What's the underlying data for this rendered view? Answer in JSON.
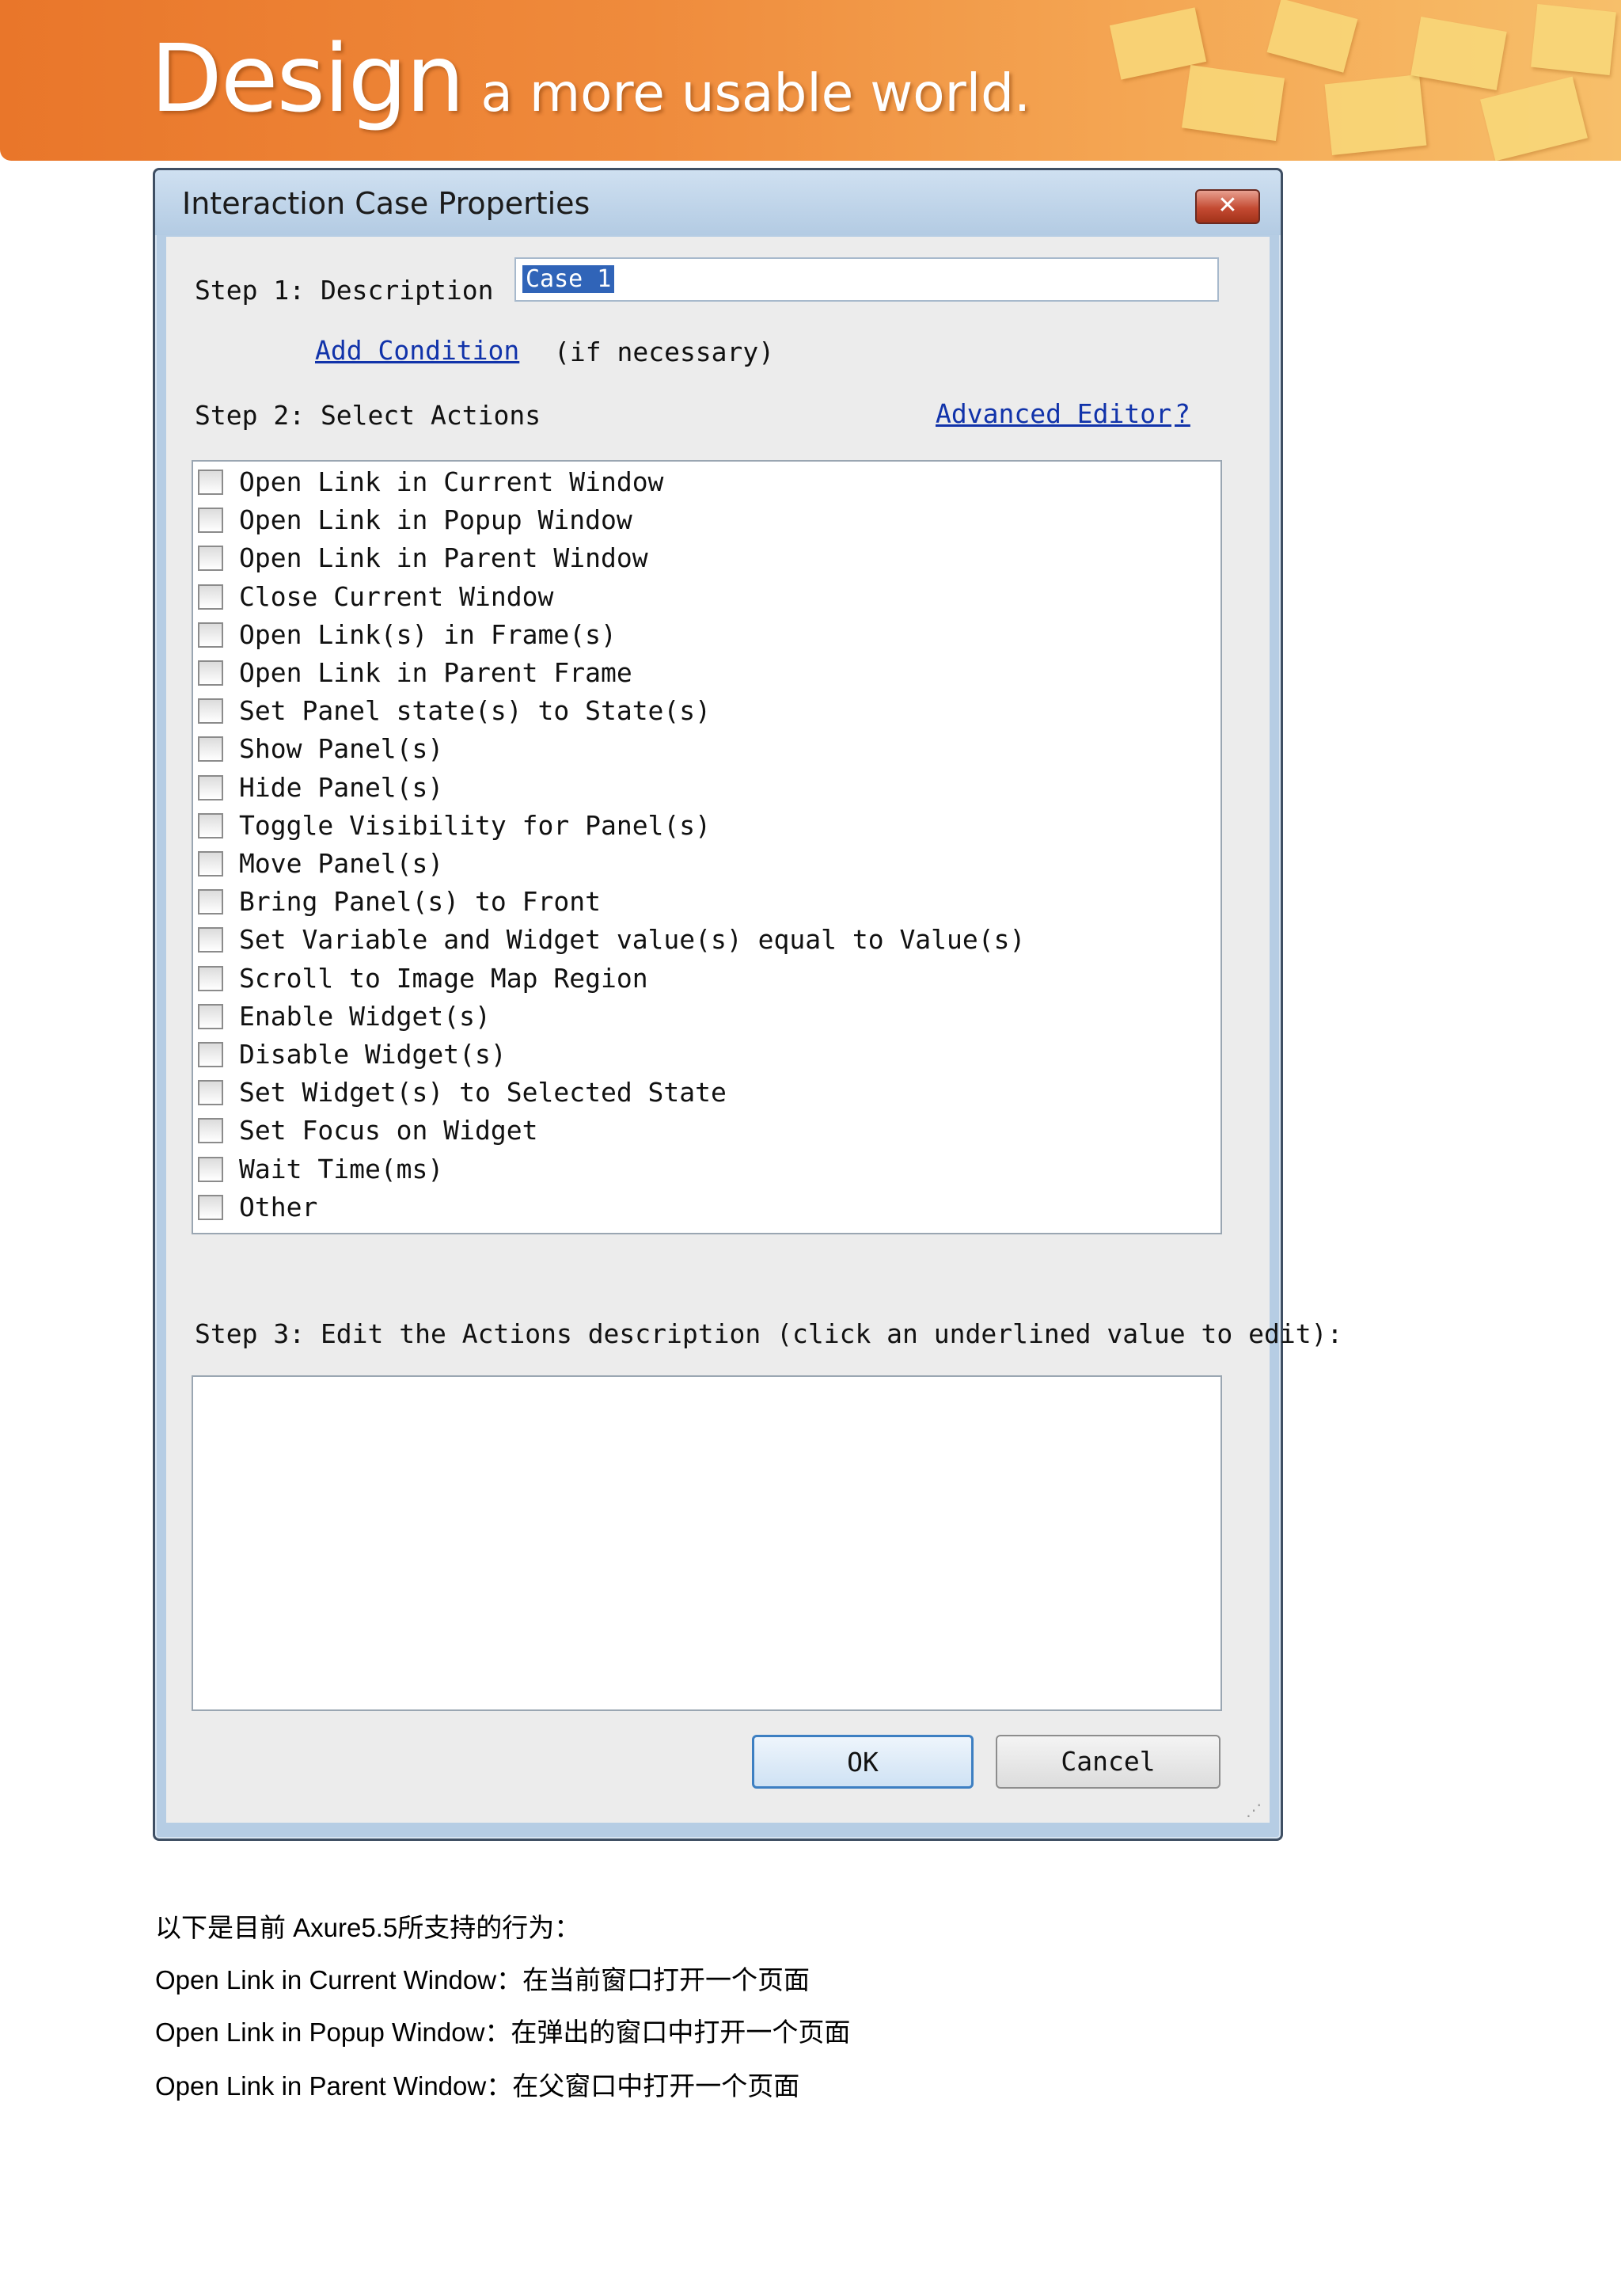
{
  "banner": {
    "title_big": "Design",
    "title_small": "a more usable world."
  },
  "dialog": {
    "title": "Interaction Case Properties",
    "close_label": "✕",
    "step1_label": "Step 1: Description",
    "description_value": "Case 1",
    "add_condition": "Add Condition",
    "if_necessary": "(if necessary)",
    "step2_label": "Step 2: Select Actions",
    "advanced_editor": "Advanced Editor",
    "help": "?",
    "actions": [
      "Open Link in Current Window",
      "Open Link in Popup Window",
      "Open Link in Parent Window",
      "Close Current Window",
      "Open Link(s) in Frame(s)",
      "Open Link in Parent Frame",
      "Set Panel state(s) to State(s)",
      "Show Panel(s)",
      "Hide Panel(s)",
      "Toggle Visibility for Panel(s)",
      "Move Panel(s)",
      "Bring Panel(s) to Front",
      "Set Variable and Widget value(s) equal to Value(s)",
      "Scroll to Image Map Region",
      "Enable Widget(s)",
      "Disable Widget(s)",
      "Set Widget(s) to Selected State",
      "Set Focus on Widget",
      "Wait Time(ms)",
      "Other"
    ],
    "step3_label": "Step 3: Edit the Actions description (click an underlined value to edit):",
    "ok_label": "OK",
    "cancel_label": "Cancel"
  },
  "text": {
    "intro": "以下是目前 Axure5.5所支持的行为：",
    "lines": [
      "Open Link in Current Window：在当前窗口打开一个页面",
      "Open Link in Popup Window：在弹出的窗口中打开一个页面",
      "Open Link in Parent Window：在父窗口中打开一个页面"
    ]
  }
}
